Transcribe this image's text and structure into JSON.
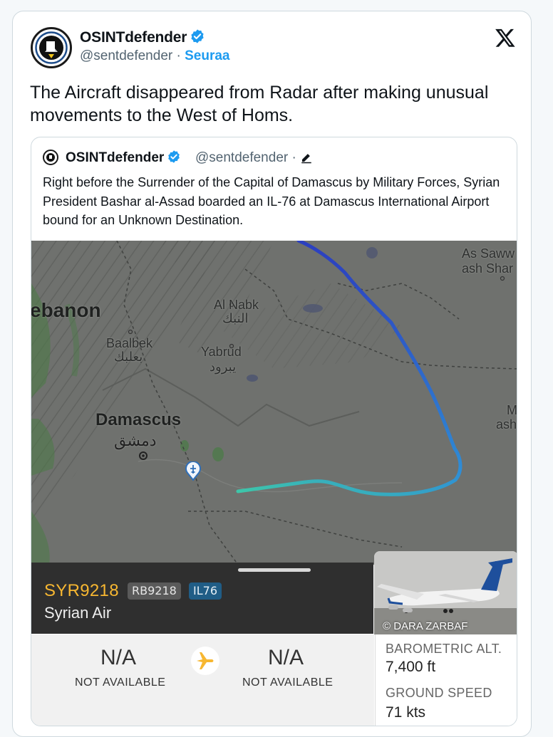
{
  "author": {
    "name": "OSINTdefender",
    "handle": "@sentdefender",
    "separator": " · ",
    "follow": "Seuraa"
  },
  "tweet": {
    "text": "The Aircraft disappeared from Radar after making unusual movements to the West of Homs."
  },
  "quote": {
    "name": "OSINTdefender",
    "handle": "@sentdefender",
    "separator": " · ",
    "text": "Right before the Surrender of the Capital of Damascus by Military Forces, Syrian President Bashar al-Assad boarded an IL-76 at Damascus International Airport bound for an Unknown Destination."
  },
  "map": {
    "labels": {
      "lebanon": "ebanon",
      "al_nabk": "Al Nabk",
      "al_nabk_ar": "النبك",
      "baalbek": "Baalbek",
      "baalbek_ar": "بعلبك",
      "yabrud": "Yabrud",
      "yabrud_ar": "يبرود",
      "damascus": "Damascus",
      "damascus_ar": "دمشق",
      "as_sawwa": "As Saww",
      "ash_shar": "ash Shar",
      "m": "M",
      "ash": "ash"
    },
    "colors": {
      "track_start": "#3ec8a8",
      "track_end": "#2c3fbf"
    }
  },
  "flight": {
    "callsign": "SYR9218",
    "tag1": "RB9218",
    "tag2": "IL76",
    "airline": "Syrian Air",
    "photo_credit": "© DARA ZARBAF",
    "origin": {
      "value": "N/A",
      "label": "NOT AVAILABLE"
    },
    "destination": {
      "value": "N/A",
      "label": "NOT AVAILABLE"
    },
    "baro_label": "BAROMETRIC ALT.",
    "baro_value": "7,400 ft",
    "speed_label": "GROUND SPEED",
    "speed_value": "71 kts",
    "accent": "#f7b731"
  }
}
